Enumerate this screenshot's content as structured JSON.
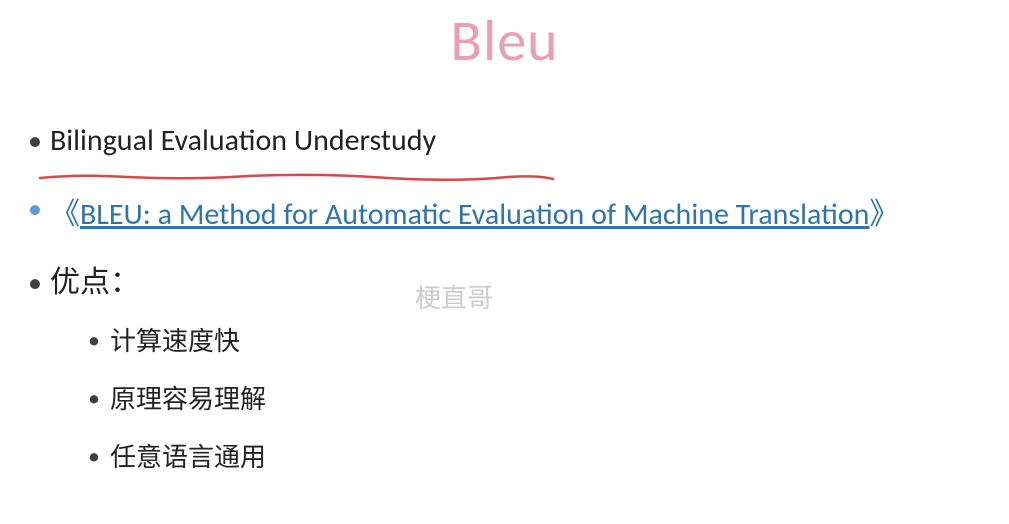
{
  "title": "Bleu",
  "items": {
    "definition": "Bilingual Evaluation Understudy",
    "paper_bracket_left": "《",
    "paper_link": "BLEU: a Method for Automatic Evaluation of Machine Translation",
    "paper_bracket_right": "》",
    "advantages_label": "优点：",
    "advantages": [
      "计算速度快",
      "原理容易理解",
      "任意语言通用"
    ]
  },
  "watermark": "梗直哥"
}
